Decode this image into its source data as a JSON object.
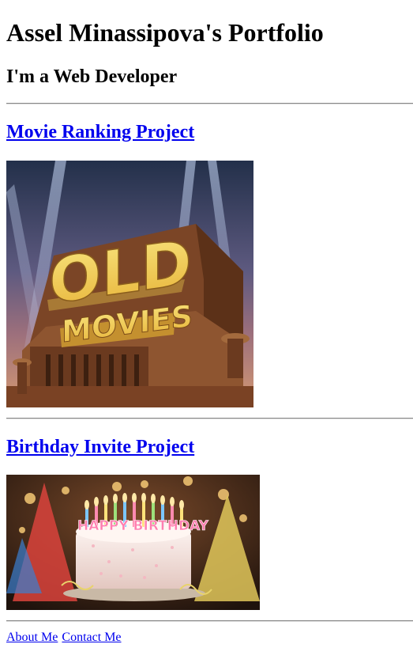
{
  "header": {
    "title": "Assel Minassipova's Portfolio",
    "subtitle": "I'm a Web Developer"
  },
  "projects": [
    {
      "link_label": "Movie Ranking Project",
      "art_text": [
        "OLD",
        "MOVIES"
      ]
    },
    {
      "link_label": "Birthday Invite Project",
      "art_text": "HAPPY BIRTHDAY"
    }
  ],
  "footer": {
    "links": [
      "About Me",
      "Contact Me"
    ]
  },
  "colors": {
    "link": "#0000ee",
    "divider": "#888888"
  }
}
